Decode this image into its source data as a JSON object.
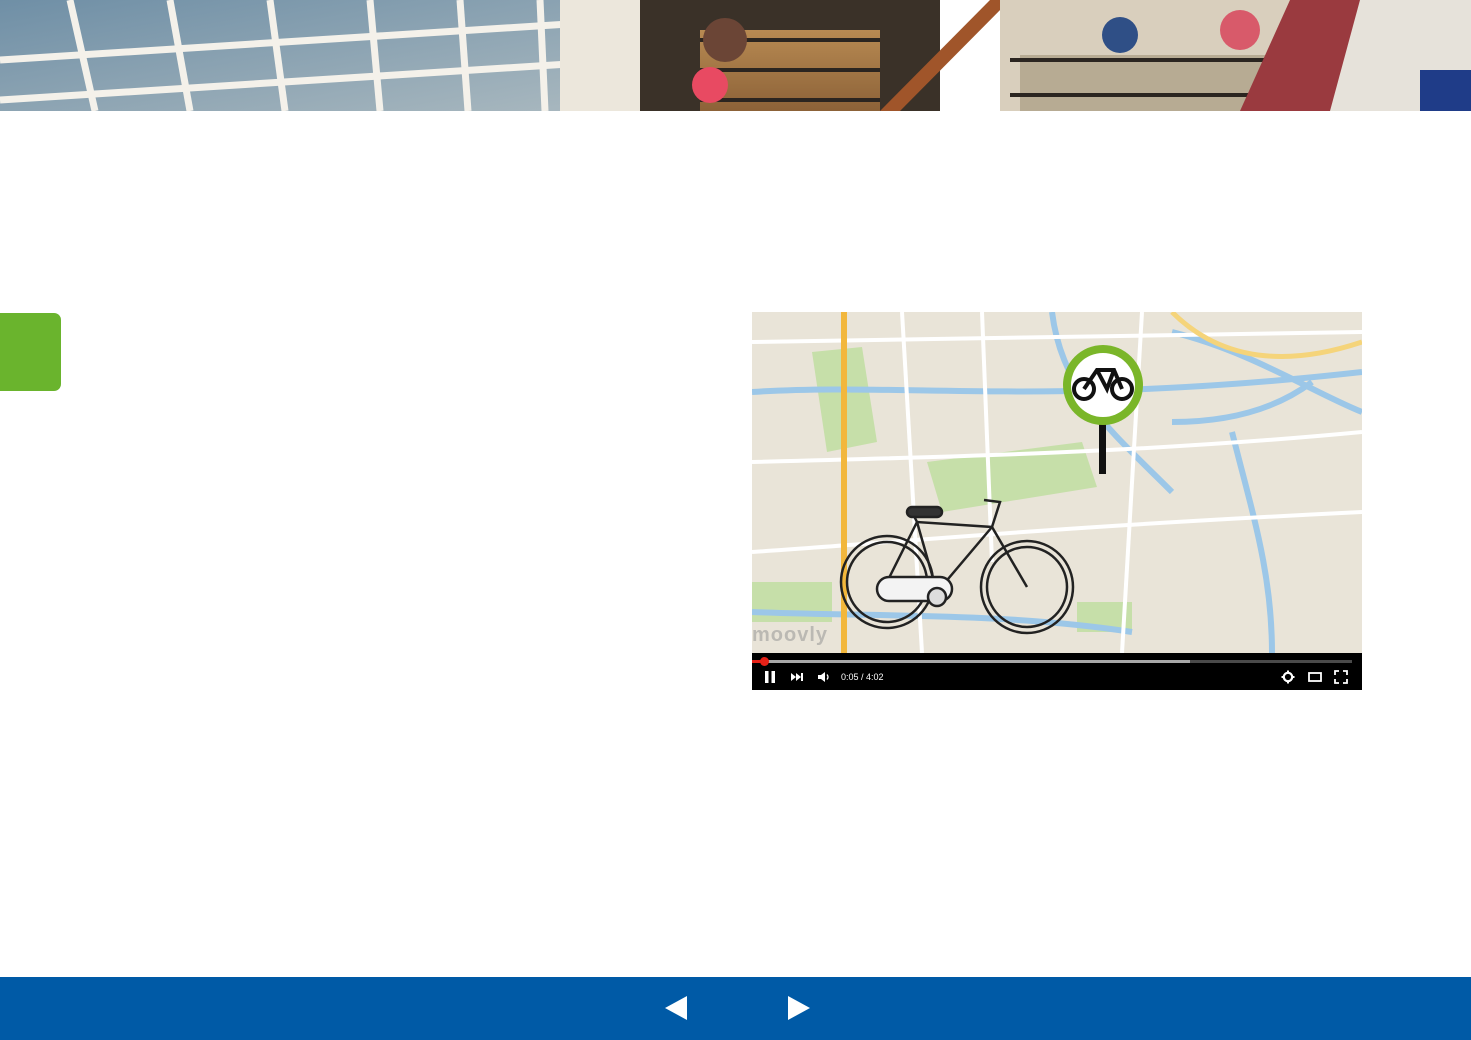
{
  "header": {
    "image": "school-staircase-photo"
  },
  "sidebar": {
    "tab_color": "#6ab42d"
  },
  "video": {
    "watermark": "moovly",
    "time": "0:05 / 4:02",
    "progress_played": 0.02,
    "progress_loaded": 0.73,
    "icons": {
      "play_pause": "pause-icon",
      "next": "next-icon",
      "volume": "volume-icon",
      "settings": "gear-icon",
      "theater": "theater-mode-icon",
      "fullscreen": "fullscreen-icon"
    },
    "map_sign_icon": "bicycle-sign-icon"
  },
  "footer": {
    "color": "#005aa6",
    "prev_icon": "left-arrow-icon",
    "next_icon": "right-arrow-icon"
  }
}
